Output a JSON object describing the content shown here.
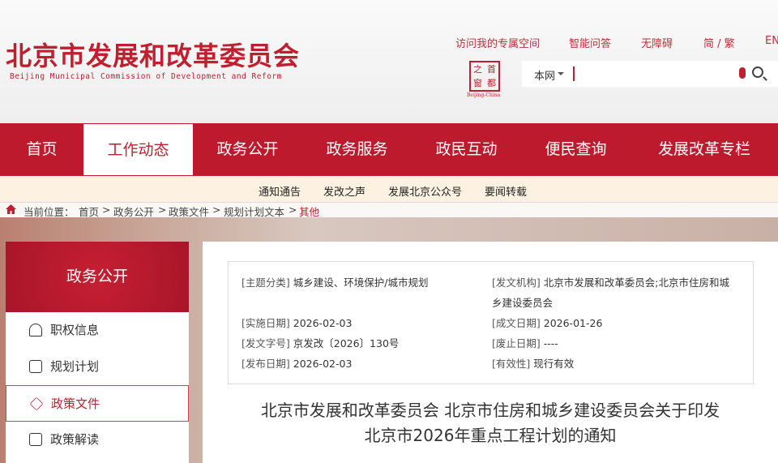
{
  "header": {
    "logo_cn": "北京市发展和改革委员会",
    "logo_en": "Beijing Municipal Commission of Development and Reform",
    "top_links": [
      "访问我的专属空间",
      "智能问答",
      "无障碍",
      "简 / 繁",
      "EN"
    ],
    "seal": {
      "chars": [
        "之",
        "首",
        "窗",
        "都"
      ],
      "en": "Beijing-China"
    },
    "search": {
      "scope": "本网",
      "value": ""
    }
  },
  "nav": {
    "items": [
      "首页",
      "工作动态",
      "政务公开",
      "政务服务",
      "政民互动",
      "便民查询",
      "发展改革专栏"
    ],
    "active": "工作动态"
  },
  "subnav": {
    "items": [
      "通知通告",
      "发改之声",
      "发展北京公众号",
      "要闻转载"
    ]
  },
  "breadcrumb": {
    "label": "当前位置：",
    "items": [
      "首页",
      "政务公开",
      "政策文件",
      "规划计划文本",
      "其他"
    ],
    "sep": ">"
  },
  "sidebar": {
    "title": "政务公开",
    "items": [
      "职权信息",
      "规划计划",
      "政策文件",
      "政策解读"
    ],
    "active": "政策文件"
  },
  "meta": {
    "topic": {
      "label": "[主题分类]",
      "value": "城乡建设、环境保护/城市规划"
    },
    "issuer": {
      "label": "[发文机构]",
      "value1": "北京市发展和改革委员会;北京市住房和城",
      "value2": "乡建设委员会"
    },
    "effective_date": {
      "label": "[实施日期]",
      "value": "2026-02-03"
    },
    "written_date": {
      "label": "[成文日期]",
      "value": "2026-01-26"
    },
    "doc_no": {
      "label": "[发文字号]",
      "value": "京发改〔2026〕130号"
    },
    "repeal_date": {
      "label": "[废止日期]",
      "value": "----"
    },
    "publish_date": {
      "label": "[发布日期]",
      "value": "2026-02-03"
    },
    "validity": {
      "label": "[有效性]",
      "value": "现行有效"
    }
  },
  "doc": {
    "title_line1": "北京市发展和改革委员会 北京市住房和城乡建设委员会关于印发",
    "title_line2": "北京市2026年重点工程计划的通知"
  }
}
